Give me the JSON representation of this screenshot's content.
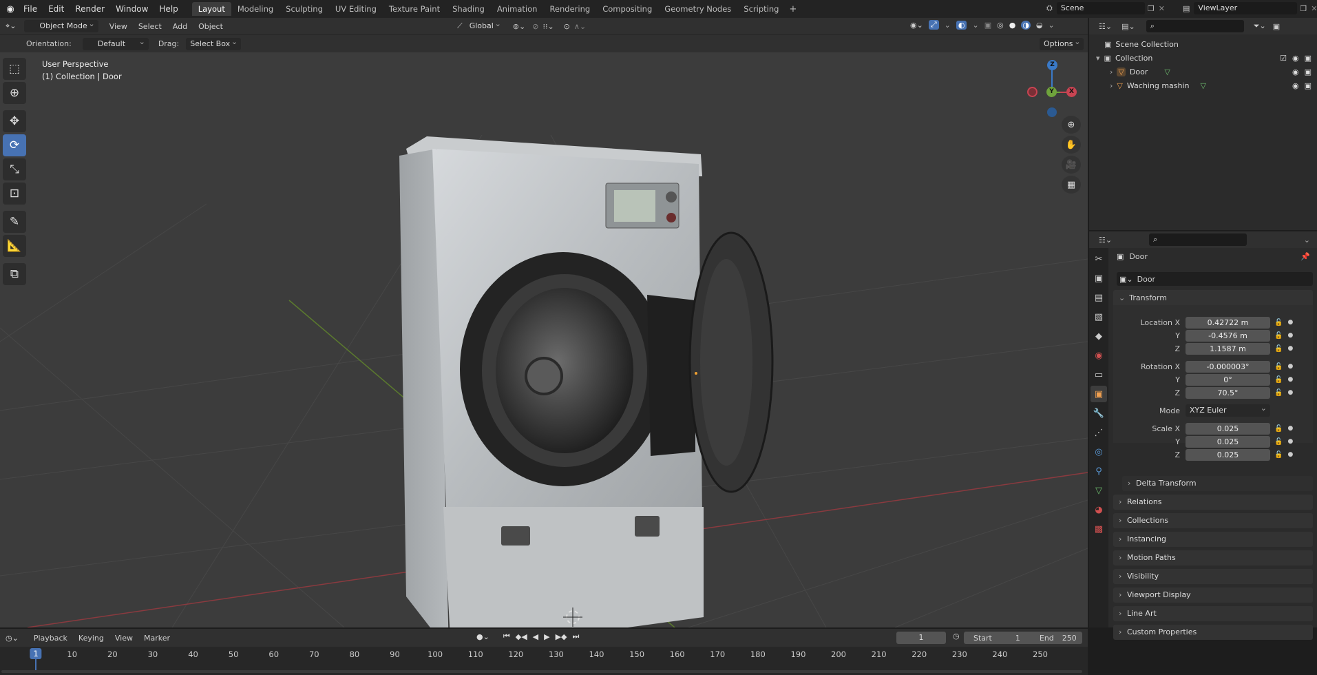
{
  "menu": [
    "File",
    "Edit",
    "Render",
    "Window",
    "Help"
  ],
  "workspaces": [
    "Layout",
    "Modeling",
    "Sculpting",
    "UV Editing",
    "Texture Paint",
    "Shading",
    "Animation",
    "Rendering",
    "Compositing",
    "Geometry Nodes",
    "Scripting"
  ],
  "workspace_add": "+",
  "scene_name": "Scene",
  "view_layer": "ViewLayer",
  "header": {
    "mode": "Object Mode",
    "menus": [
      "View",
      "Select",
      "Add",
      "Object"
    ],
    "transform_orientation": "Global",
    "options_label": "Options"
  },
  "tool_settings": {
    "orientation_label": "Orientation:",
    "orientation_value": "Default",
    "drag_label": "Drag:",
    "drag_value": "Select Box"
  },
  "viewport": {
    "perspective_text": "User Perspective",
    "collection_text": "(1) Collection | Door",
    "gizmo_labels": {
      "x": "X",
      "y": "Y",
      "z": "Z"
    }
  },
  "outliner": {
    "scene_collection": "Scene Collection",
    "collection": "Collection",
    "objects": [
      "Door",
      "Waching mashin"
    ]
  },
  "properties": {
    "object_name": "Door",
    "data_name": "Door",
    "transform_title": "Transform",
    "location": {
      "label": "Location X",
      "y_label": "Y",
      "z_label": "Z",
      "x": "0.42722 m",
      "y": "-0.4576 m",
      "z": "1.1587 m"
    },
    "rotation": {
      "label": "Rotation X",
      "y_label": "Y",
      "z_label": "Z",
      "x": "-0.000003°",
      "y": "0°",
      "z": "70.5°"
    },
    "mode_label": "Mode",
    "mode_value": "XYZ Euler",
    "scale": {
      "label": "Scale X",
      "y_label": "Y",
      "z_label": "Z",
      "x": "0.025",
      "y": "0.025",
      "z": "0.025"
    },
    "delta_transform": "Delta Transform",
    "panels": [
      "Relations",
      "Collections",
      "Instancing",
      "Motion Paths",
      "Visibility",
      "Viewport Display",
      "Line Art",
      "Custom Properties"
    ]
  },
  "timeline": {
    "menus": [
      "Playback",
      "Keying",
      "View",
      "Marker"
    ],
    "current_frame": "1",
    "start_label": "Start",
    "start_value": "1",
    "end_label": "End",
    "end_value": "250",
    "ruler": [
      "1",
      "10",
      "20",
      "30",
      "40",
      "50",
      "60",
      "70",
      "80",
      "90",
      "100",
      "110",
      "120",
      "130",
      "140",
      "150",
      "160",
      "170",
      "180",
      "190",
      "200",
      "210",
      "220",
      "230",
      "240",
      "250"
    ]
  },
  "colors": {
    "accent": "#4772b3",
    "x_axis": "#c84452",
    "y_axis": "#6fa33c",
    "z_axis": "#3a7ac8",
    "active_frame": "#4772b3"
  }
}
